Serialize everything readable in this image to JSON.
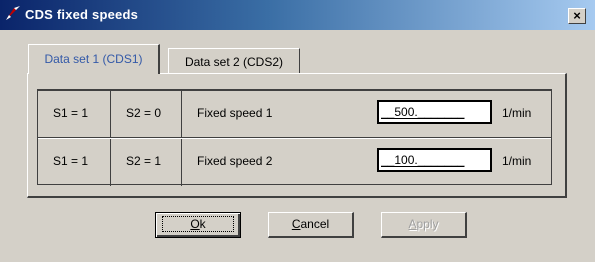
{
  "window": {
    "title": "CDS fixed speeds",
    "close_label": "×"
  },
  "tabs": [
    {
      "label": "Data set 1 (CDS1)",
      "active": true
    },
    {
      "label": "Data set 2 (CDS2)",
      "active": false
    }
  ],
  "rows": [
    {
      "s1": "S1 = 1",
      "s2": "S2 = 0",
      "label": "Fixed speed 1",
      "value": "__500._______",
      "unit": "1/min"
    },
    {
      "s1": "S1 = 1",
      "s2": "S2 = 1",
      "label": "Fixed speed 2",
      "value": "__100._______",
      "unit": "1/min"
    }
  ],
  "buttons": {
    "ok": {
      "mnemonic": "O",
      "rest": "k"
    },
    "cancel": {
      "mnemonic": "C",
      "rest": "ancel"
    },
    "apply": {
      "mnemonic": "A",
      "rest": "pply",
      "enabled": false
    }
  },
  "colors": {
    "title_gradient_start": "#0a246a",
    "title_gradient_end": "#a6caf0",
    "face": "#d4d0c8",
    "active_tab_text": "#3359a8"
  },
  "icons": [
    "app-icon",
    "close-icon"
  ]
}
